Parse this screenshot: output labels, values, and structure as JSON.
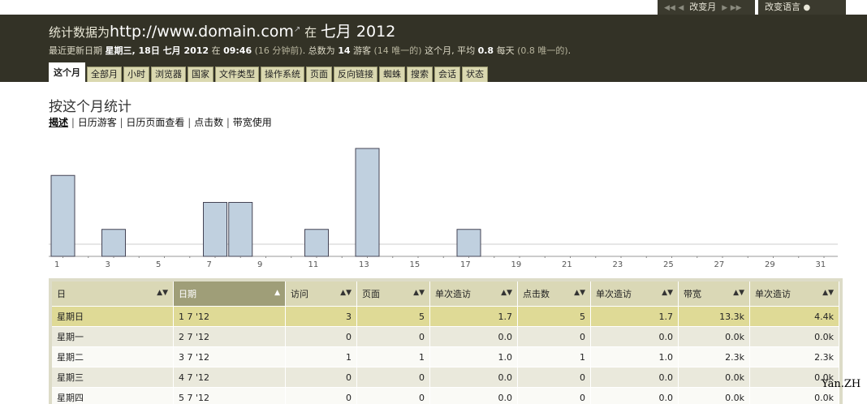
{
  "topbar": {
    "month_controls": {
      "first": "◀◀",
      "prev": "◀",
      "label": "改变月",
      "next": "▶",
      "last": "▶▶"
    },
    "language_label": "改变语言",
    "language_icon": "speech-bubble-icon"
  },
  "header": {
    "title_prefix": "统计数据为",
    "url": "http://www.domain.com",
    "external_icon": "↗",
    "title_in": "在",
    "period": "七月 2012",
    "summary": {
      "p1": "最近更新日期 ",
      "last_update": "星期三, 18日 七月 2012",
      "p2": " 在 ",
      "time": "09:46",
      "ago": "(16 分钟前)",
      "p3": ". 总数为 ",
      "total": "14",
      "p4": " 游客 ",
      "unique": "(14 唯一的)",
      "p5": " 这个月, 平均 ",
      "avg": "0.8",
      "p6": " 每天 ",
      "avg_unique": "(0.8 唯一的)",
      "p7": "."
    }
  },
  "tabs": [
    {
      "label": "这个月",
      "active": true
    },
    {
      "label": "全部月"
    },
    {
      "label": "小时"
    },
    {
      "label": "浏览器"
    },
    {
      "label": "国家"
    },
    {
      "label": "文件类型"
    },
    {
      "label": "操作系统"
    },
    {
      "label": "页面"
    },
    {
      "label": "反向链接"
    },
    {
      "label": "蜘蛛"
    },
    {
      "label": "搜索"
    },
    {
      "label": "会话"
    },
    {
      "label": "状态"
    }
  ],
  "page_title": "按这个月统计",
  "subnav": [
    "揭述",
    "日历游客",
    "日历页面查看",
    "点击数",
    "带宽使用"
  ],
  "chart_data": {
    "type": "bar",
    "categories": [
      "1",
      "2",
      "3",
      "4",
      "5",
      "6",
      "7",
      "8",
      "9",
      "10",
      "11",
      "12",
      "13",
      "14",
      "15",
      "16",
      "17",
      "18",
      "19",
      "20",
      "21",
      "22",
      "23",
      "24",
      "25",
      "26",
      "27",
      "28",
      "29",
      "30",
      "31"
    ],
    "tick_labels": [
      "1",
      "3",
      "5",
      "7",
      "9",
      "11",
      "13",
      "15",
      "17",
      "19",
      "21",
      "23",
      "25",
      "27",
      "29",
      "31"
    ],
    "values": [
      3,
      0,
      1,
      0,
      0,
      0,
      2,
      2,
      0,
      0,
      1,
      0,
      4,
      0,
      0,
      0,
      1,
      0,
      0,
      0,
      0,
      0,
      0,
      0,
      0,
      0,
      0,
      0,
      0,
      0,
      0
    ],
    "ylim": [
      0,
      4
    ],
    "bar_color": "#c0d0df"
  },
  "table": {
    "headers": [
      "日",
      "日期",
      "访问",
      "页面",
      "单次造访",
      "点击数",
      "单次造访",
      "带宽",
      "单次造访"
    ],
    "rows": [
      [
        "星期日",
        "1 7 '12",
        "3",
        "5",
        "1.7",
        "5",
        "1.7",
        "13.3k",
        "4.4k"
      ],
      [
        "星期一",
        "2 7 '12",
        "0",
        "0",
        "0.0",
        "0",
        "0.0",
        "0.0k",
        "0.0k"
      ],
      [
        "星期二",
        "3 7 '12",
        "1",
        "1",
        "1.0",
        "1",
        "1.0",
        "2.3k",
        "2.3k"
      ],
      [
        "星期三",
        "4 7 '12",
        "0",
        "0",
        "0.0",
        "0",
        "0.0",
        "0.0k",
        "0.0k"
      ],
      [
        "星期四",
        "5 7 '12",
        "0",
        "0",
        "0.0",
        "0",
        "0.0",
        "0.0k",
        "0.0k"
      ]
    ]
  },
  "watermark": "Yan.ZH"
}
